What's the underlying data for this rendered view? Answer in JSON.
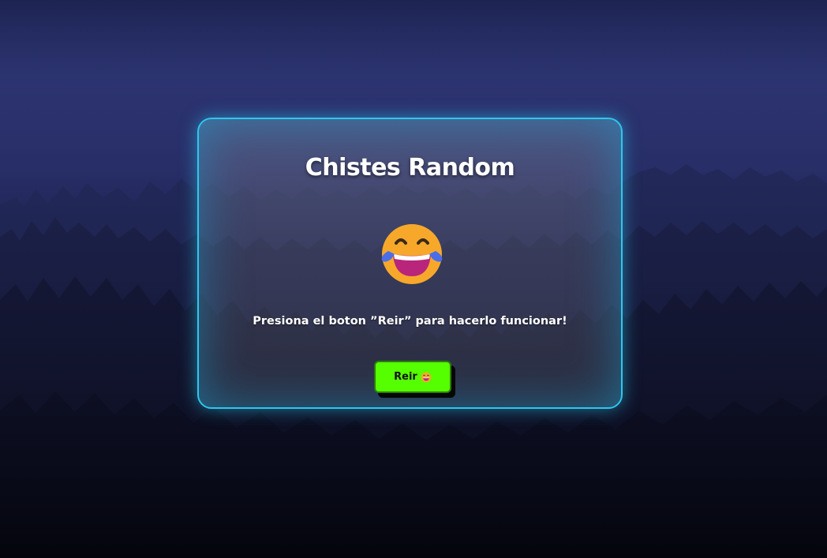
{
  "card": {
    "title": "Chistes Random",
    "message": "Presiona el boton ”Reir” para hacerlo funcionar!",
    "button_label": "Reir",
    "main_emoji": "face-with-tears-of-joy-icon",
    "button_emoji": "laughing-face-icon"
  },
  "colors": {
    "card_border": "#2fc6ee",
    "button_bg": "#55ff00",
    "emoji_face": "#f7a82b",
    "emoji_tears": "#4a6ee8",
    "emoji_mouth": "#b9257a"
  }
}
